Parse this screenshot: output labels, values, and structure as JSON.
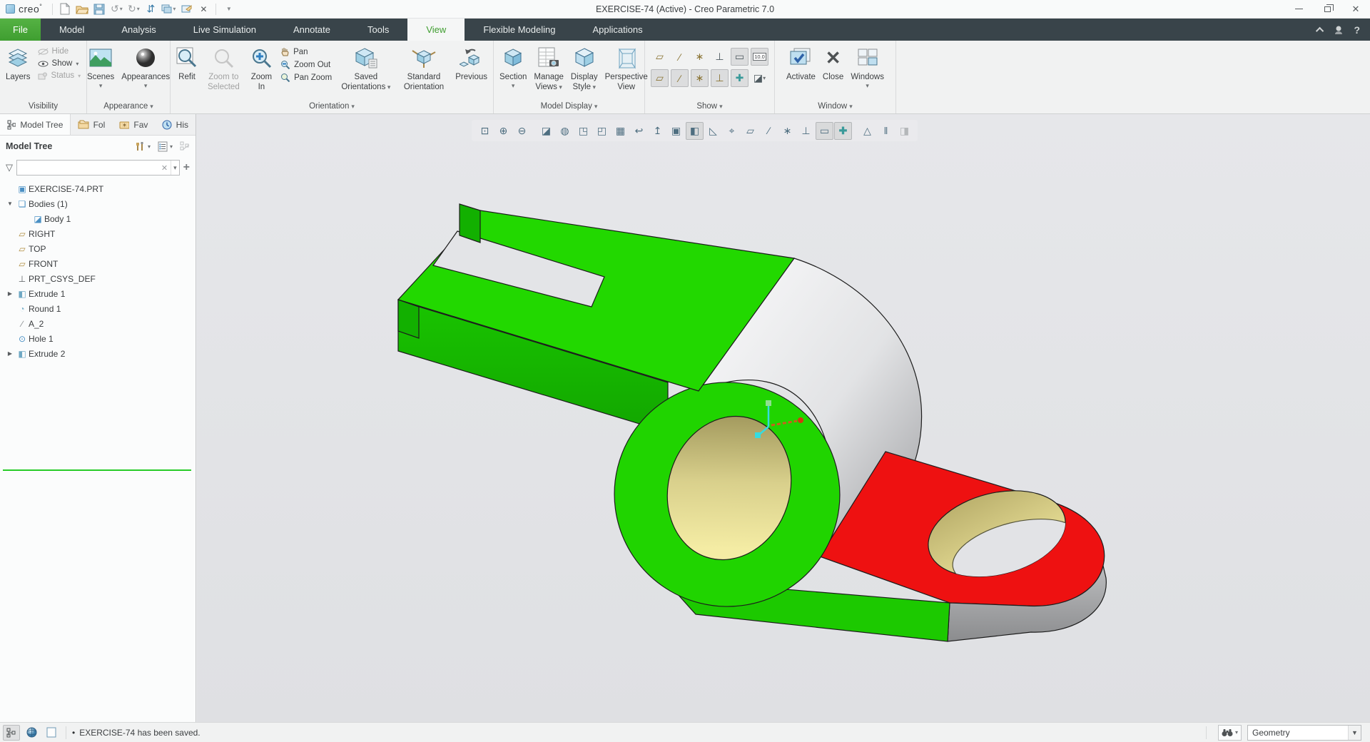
{
  "title_bar": {
    "logo_text": "creo",
    "app_title": "EXERCISE-74 (Active) - Creo Parametric 7.0"
  },
  "quick_access": {
    "items": [
      {
        "name": "new-file"
      },
      {
        "name": "open-file"
      },
      {
        "name": "save"
      },
      {
        "name": "undo",
        "dropdown": true
      },
      {
        "name": "redo",
        "dropdown": true
      },
      {
        "name": "regenerate"
      },
      {
        "name": "window-switch",
        "dropdown": true
      },
      {
        "name": "send-to"
      },
      {
        "name": "close-window"
      },
      {
        "name": "customize-quick-access",
        "dropdown": true
      }
    ]
  },
  "tabs": {
    "items": [
      {
        "label": "File"
      },
      {
        "label": "Model"
      },
      {
        "label": "Analysis"
      },
      {
        "label": "Live Simulation"
      },
      {
        "label": "Annotate"
      },
      {
        "label": "Tools"
      },
      {
        "label": "View"
      },
      {
        "label": "Flexible Modeling"
      },
      {
        "label": "Applications"
      }
    ],
    "help_label": "?"
  },
  "ribbon": {
    "groups": [
      {
        "label": "Visibility"
      },
      {
        "label": "Appearance"
      },
      {
        "label": "Orientation"
      },
      {
        "label": "Model Display"
      },
      {
        "label": "Show"
      },
      {
        "label": "Window"
      }
    ],
    "visibility": {
      "layers": "Layers",
      "hide": "Hide",
      "show": "Show",
      "status": "Status"
    },
    "appearance": {
      "scenes": "Scenes",
      "appearances": "Appearances"
    },
    "orientation": {
      "refit": "Refit",
      "zoom_to_selected": "Zoom to Selected",
      "zoom_in": "Zoom In",
      "pan": "Pan",
      "zoom_out": "Zoom Out",
      "pan_zoom": "Pan Zoom",
      "saved_orientations": "Saved Orientations",
      "standard_orientation": "Standard Orientation",
      "previous": "Previous"
    },
    "model_display": {
      "section": "Section",
      "manage_views": "Manage Views",
      "display_style": "Display Style",
      "perspective_view": "Perspective View"
    },
    "window": {
      "activate": "Activate",
      "close": "Close",
      "windows": "Windows"
    },
    "show_toggles": {
      "row1": [
        {
          "name": "plane-display",
          "glyph": "▱",
          "pressed": false
        },
        {
          "name": "axis-display",
          "glyph": "∕",
          "pressed": false
        },
        {
          "name": "point-display",
          "glyph": "∗",
          "pressed": false
        },
        {
          "name": "csys-display",
          "glyph": "⊥",
          "pressed": false
        },
        {
          "name": "annotation-display",
          "glyph": "▭",
          "pressed": true
        },
        {
          "name": "dimension-tolerance-display",
          "glyph": "10.0",
          "pressed": false
        }
      ],
      "row2": [
        {
          "name": "plane-tag-display",
          "glyph": "▱",
          "pressed": true
        },
        {
          "name": "axis-tag-display",
          "glyph": "∕",
          "pressed": true
        },
        {
          "name": "point-tag-display",
          "glyph": "∗",
          "pressed": true
        },
        {
          "name": "csys-tag-display",
          "glyph": "⊥",
          "pressed": true
        },
        {
          "name": "spin-center-display",
          "glyph": "✚",
          "pressed": true
        },
        {
          "name": "section-display",
          "glyph": "◪",
          "pressed": false
        }
      ]
    }
  },
  "panel": {
    "nav_tabs": [
      {
        "label": "Model Tree"
      },
      {
        "label": "Fol"
      },
      {
        "label": "Fav"
      },
      {
        "label": "His"
      }
    ],
    "header_title": "Model Tree",
    "filter": {
      "placeholder": "",
      "value": ""
    },
    "tree": {
      "items": [
        {
          "label": "EXERCISE-74.PRT"
        },
        {
          "label": "Bodies (1)"
        },
        {
          "label": "Body 1"
        },
        {
          "label": "RIGHT"
        },
        {
          "label": "TOP"
        },
        {
          "label": "FRONT"
        },
        {
          "label": "PRT_CSYS_DEF"
        },
        {
          "label": "Extrude 1"
        },
        {
          "label": "Round 1"
        },
        {
          "label": "A_2"
        },
        {
          "label": "Hole 1"
        },
        {
          "label": "Extrude 2"
        }
      ]
    }
  },
  "icons": {
    "part": "▣",
    "bodies": "❏",
    "body": "◪",
    "plane": "▱",
    "csys": "⊥",
    "extrude": "◧",
    "round": "◔",
    "axis": "∕",
    "hole": "⊙",
    "tri_down": "▼",
    "tri_right": "▶",
    "funnel": "▽",
    "clear": "✕",
    "dropdown": "▾",
    "plus": "+",
    "minimize": "",
    "close": "✕",
    "help": "?"
  },
  "viewport_toolbar": {
    "buttons": [
      {
        "name": "refit",
        "glyph": "⊡",
        "pressed": false
      },
      {
        "name": "zoom-in",
        "glyph": "⊕",
        "pressed": false
      },
      {
        "name": "zoom-out",
        "glyph": "⊖",
        "pressed": false
      },
      {
        "name": "repaint",
        "glyph": "◪",
        "pressed": false
      },
      {
        "name": "shading-quality",
        "glyph": "◍",
        "pressed": false
      },
      {
        "name": "saved-orientations",
        "glyph": "◳",
        "pressed": false
      },
      {
        "name": "reorient",
        "glyph": "◰",
        "pressed": false
      },
      {
        "name": "view-manager",
        "glyph": "▦",
        "pressed": false
      },
      {
        "name": "previous-orientation",
        "glyph": "↩",
        "pressed": false
      },
      {
        "name": "named-views",
        "glyph": "↥",
        "pressed": false
      },
      {
        "name": "display-style",
        "glyph": "▣",
        "pressed": false
      },
      {
        "name": "shaded-view",
        "glyph": "◧",
        "pressed": true
      },
      {
        "name": "datum-display-filters",
        "glyph": "◺",
        "pressed": false
      },
      {
        "name": "annotation-filters",
        "glyph": "⌖",
        "pressed": false
      },
      {
        "name": "plane-display",
        "glyph": "▱",
        "pressed": false
      },
      {
        "name": "axis-display",
        "glyph": "∕",
        "pressed": false
      },
      {
        "name": "point-display",
        "glyph": "∗",
        "pressed": false
      },
      {
        "name": "csys-display",
        "glyph": "⊥",
        "pressed": false
      },
      {
        "name": "annotation-display",
        "glyph": "▭",
        "pressed": true
      },
      {
        "name": "spin-center",
        "glyph": "✚",
        "pressed": true
      },
      {
        "name": "geometry-checks",
        "glyph": "△",
        "pressed": false
      },
      {
        "name": "pause",
        "glyph": "‖",
        "pressed": false
      },
      {
        "name": "exit-fly-through",
        "glyph": "◨",
        "pressed": false,
        "disabled": true
      }
    ]
  },
  "model": {
    "name": "EXERCISE-74",
    "colors": {
      "green_top": "#22d800",
      "green_front": "#16bb00",
      "green_band": "#1cc900",
      "green_annulus": "#20d400",
      "red_face": "#ee1111",
      "white_cylinder": "#f7f7f8",
      "gray_side": "#a2a3a5",
      "bore_tan_dark": "#9a9157",
      "bore_tan_light": "#f2e9a0",
      "edge": "#1c1c1c",
      "spin_center_cyan": "#35dce0",
      "spin_center_orange": "#cc5f1e",
      "spin_center_dot": "#8fe08f"
    }
  },
  "status_bar": {
    "bullet": "•",
    "message": "EXERCISE-74 has been saved.",
    "selection_filter_value": "Geometry"
  }
}
